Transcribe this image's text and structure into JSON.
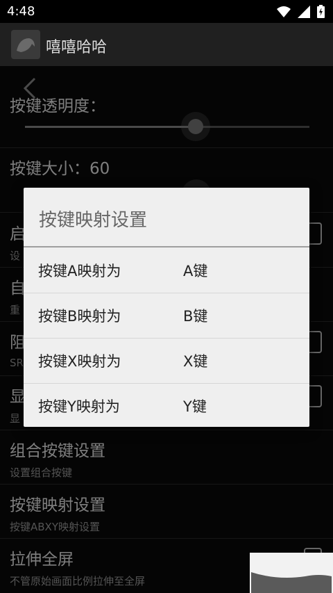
{
  "status": {
    "time": "4:48"
  },
  "app": {
    "title": "嘻嘻哈哈"
  },
  "prefs": {
    "partial_top_title": "按键透明度：",
    "key_size_title": "按键大小：60",
    "start_title_partial": "启",
    "start_summary_partial": "设",
    "auto_title_partial": "自",
    "auto_summary_partial": "重",
    "block_title_partial": "阻",
    "block_summary_partial": "SR",
    "show_title_partial": "显",
    "show_summary_partial": "显",
    "combo_title": "组合按键设置",
    "combo_summary": "设置组合按键",
    "mapping_title": "按键映射设置",
    "mapping_summary": "按键ABXY映射设置",
    "stretch_title": "拉伸全屏",
    "stretch_summary": "不管原始画面比例拉伸至全屏"
  },
  "sliders": {
    "alpha_fraction": 0.6
  },
  "dialog": {
    "title": "按键映射设置",
    "items": [
      {
        "label": "按键A映射为",
        "value": "A键"
      },
      {
        "label": "按键B映射为",
        "value": "B键"
      },
      {
        "label": "按键X映射为",
        "value": "X键"
      },
      {
        "label": "按键Y映射为",
        "value": "Y键"
      }
    ]
  },
  "icons": [
    "wifi-icon",
    "signal-icon",
    "battery-icon",
    "back-arrow-icon",
    "app-logo-icon"
  ],
  "colors": {
    "dialog_bg": "#efefef",
    "dialog_title": "#666666",
    "appbar": "#202020"
  }
}
